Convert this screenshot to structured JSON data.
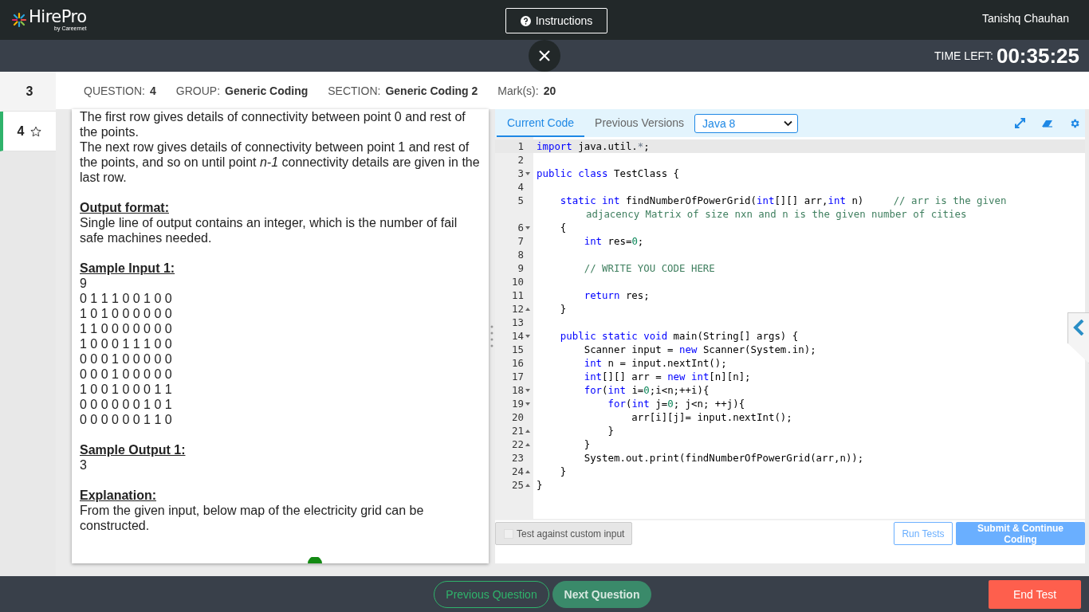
{
  "header": {
    "logo": "HirePro",
    "logo_sub": "by Careernet",
    "instructions_button": "Instructions",
    "user": "Tanishq Chauhan"
  },
  "timer": {
    "label": "TIME LEFT:",
    "value": "00:35:25"
  },
  "question_nav": [
    {
      "label": "3",
      "selected": false
    },
    {
      "label": "4",
      "selected": true
    }
  ],
  "info": [
    {
      "label": "QUESTION:",
      "value": "4"
    },
    {
      "label": "GROUP:",
      "value": "Generic Coding"
    },
    {
      "label": "SECTION:",
      "value": "Generic Coding 2"
    },
    {
      "label": "Mark(s):",
      "value": "20"
    }
  ],
  "question": [
    {
      "kind": "text",
      "text": "The first row gives details of connectivity between point 0 and rest of the points."
    },
    {
      "kind": "text",
      "text": "The next row gives details of connectivity between point 1 and rest of the points, and so on until point *n-1* connectivity details are given in the last row."
    },
    {
      "kind": "blank"
    },
    {
      "kind": "heading",
      "text": "Output format:"
    },
    {
      "kind": "text",
      "text": "Single line of output contains an integer, which is the number of fail safe machines needed."
    },
    {
      "kind": "blank"
    },
    {
      "kind": "heading",
      "text": "Sample Input 1:"
    },
    {
      "kind": "text",
      "text": "9"
    },
    {
      "kind": "text",
      "text": "0 1 1 1 0 0 1 0 0"
    },
    {
      "kind": "text",
      "text": "1 0 1 0 0 0 0 0 0"
    },
    {
      "kind": "text",
      "text": "1 1 0 0 0 0 0 0 0"
    },
    {
      "kind": "text",
      "text": "1 0 0 0 1 1 1 0 0"
    },
    {
      "kind": "text",
      "text": "0 0 0 1 0 0 0 0 0"
    },
    {
      "kind": "text",
      "text": "0 0 0 1 0 0 0 0 0"
    },
    {
      "kind": "text",
      "text": "1 0 0 1 0 0 0 1 1"
    },
    {
      "kind": "text",
      "text": "0 0 0 0 0 0 1 0 1"
    },
    {
      "kind": "text",
      "text": "0 0 0 0 0 0 1 1 0"
    },
    {
      "kind": "blank"
    },
    {
      "kind": "heading",
      "text": "Sample Output 1:"
    },
    {
      "kind": "text",
      "text": "3"
    },
    {
      "kind": "blank"
    },
    {
      "kind": "heading",
      "text": "Explanation:"
    },
    {
      "kind": "text",
      "text": "From the given input, below map of the electricity grid can be constructed."
    }
  ],
  "editor": {
    "tabs": [
      {
        "label": "Current Code",
        "selected": true
      },
      {
        "label": "Previous Versions",
        "selected": false
      }
    ],
    "language": "Java 8",
    "lines": [
      {
        "num": "1",
        "active": true,
        "segs": [
          {
            "kind": "kw",
            "text": "import"
          },
          {
            "kind": "plain",
            "text": " java.util."
          },
          {
            "kind": "op",
            "text": "*"
          },
          {
            "kind": "plain",
            "text": ";"
          }
        ]
      },
      {
        "num": "2"
      },
      {
        "num": "3",
        "fold_start": true,
        "segs": [
          {
            "kind": "kw",
            "text": "public class"
          },
          {
            "kind": "plain",
            "text": " TestClass {"
          }
        ]
      },
      {
        "num": "4"
      },
      {
        "num": "5",
        "segs": [
          {
            "kind": "kw",
            "text": "    static int"
          },
          {
            "kind": "plain",
            "text": " findNumberOfPowerGrid("
          },
          {
            "kind": "kw",
            "text": "int"
          },
          {
            "kind": "plain",
            "text": "[][] arr,"
          },
          {
            "kind": "kw",
            "text": "int"
          },
          {
            "kind": "plain",
            "text": " n)     "
          },
          {
            "kind": "comment",
            "text": "// arr is the given"
          }
        ],
        "wrap": [
          {
            "kind": "comment",
            "text": "adjacency Matrix of size nxn and n is the given number of cities"
          }
        ]
      },
      {
        "num": "6",
        "fold_start": true,
        "segs": [
          {
            "kind": "plain",
            "text": "    {"
          }
        ]
      },
      {
        "num": "7",
        "segs": [
          {
            "kind": "kw",
            "text": "        int"
          },
          {
            "kind": "plain",
            "text": " res="
          },
          {
            "kind": "num",
            "text": "0"
          },
          {
            "kind": "plain",
            "text": ";"
          }
        ]
      },
      {
        "num": "8"
      },
      {
        "num": "9",
        "segs": [
          {
            "kind": "comment",
            "text": "        // WRITE YOU CODE HERE"
          }
        ]
      },
      {
        "num": "10"
      },
      {
        "num": "11",
        "segs": [
          {
            "kind": "kw",
            "text": "        return"
          },
          {
            "kind": "plain",
            "text": " res;"
          }
        ]
      },
      {
        "num": "12",
        "fold_end": true,
        "segs": [
          {
            "kind": "plain",
            "text": "    }"
          }
        ]
      },
      {
        "num": "13"
      },
      {
        "num": "14",
        "fold_start": true,
        "segs": [
          {
            "kind": "kw",
            "text": "    public static void"
          },
          {
            "kind": "plain",
            "text": " main(String[] args) {"
          }
        ]
      },
      {
        "num": "15",
        "segs": [
          {
            "kind": "plain",
            "text": "        Scanner input = "
          },
          {
            "kind": "kw",
            "text": "new"
          },
          {
            "kind": "plain",
            "text": " Scanner(System.in);"
          }
        ]
      },
      {
        "num": "16",
        "segs": [
          {
            "kind": "kw",
            "text": "        int"
          },
          {
            "kind": "plain",
            "text": " n = input.nextInt();"
          }
        ]
      },
      {
        "num": "17",
        "segs": [
          {
            "kind": "kw",
            "text": "        int"
          },
          {
            "kind": "plain",
            "text": "[][] arr = "
          },
          {
            "kind": "kw",
            "text": "new int"
          },
          {
            "kind": "plain",
            "text": "[n][n];"
          }
        ]
      },
      {
        "num": "18",
        "fold_start": true,
        "segs": [
          {
            "kind": "kw",
            "text": "        for"
          },
          {
            "kind": "plain",
            "text": "("
          },
          {
            "kind": "kw",
            "text": "int"
          },
          {
            "kind": "plain",
            "text": " i="
          },
          {
            "kind": "num",
            "text": "0"
          },
          {
            "kind": "plain",
            "text": ";i<n;++i){"
          }
        ]
      },
      {
        "num": "19",
        "fold_start": true,
        "segs": [
          {
            "kind": "kw",
            "text": "            for"
          },
          {
            "kind": "plain",
            "text": "("
          },
          {
            "kind": "kw",
            "text": "int"
          },
          {
            "kind": "plain",
            "text": " j="
          },
          {
            "kind": "num",
            "text": "0"
          },
          {
            "kind": "plain",
            "text": "; j<n; ++j){"
          }
        ]
      },
      {
        "num": "20",
        "segs": [
          {
            "kind": "plain",
            "text": "                arr[i][j]= input.nextInt();"
          }
        ]
      },
      {
        "num": "21",
        "fold_end": true,
        "segs": [
          {
            "kind": "plain",
            "text": "            }"
          }
        ]
      },
      {
        "num": "22",
        "fold_end": true,
        "segs": [
          {
            "kind": "plain",
            "text": "        }"
          }
        ]
      },
      {
        "num": "23",
        "segs": [
          {
            "kind": "plain",
            "text": "        System.out.print(findNumberOfPowerGrid(arr,n));"
          }
        ]
      },
      {
        "num": "24",
        "fold_end": true,
        "segs": [
          {
            "kind": "plain",
            "text": "    }"
          }
        ]
      },
      {
        "num": "25",
        "fold_end": true,
        "segs": [
          {
            "kind": "plain",
            "text": "}"
          }
        ]
      }
    ],
    "custom_input": {
      "label": "Test against custom input",
      "checked": false
    },
    "run_button": "Run Tests",
    "submit_button": "Submit & Continue Coding"
  },
  "footer": {
    "previous": "Previous Question",
    "next": "Next Question",
    "end": "End Test"
  }
}
